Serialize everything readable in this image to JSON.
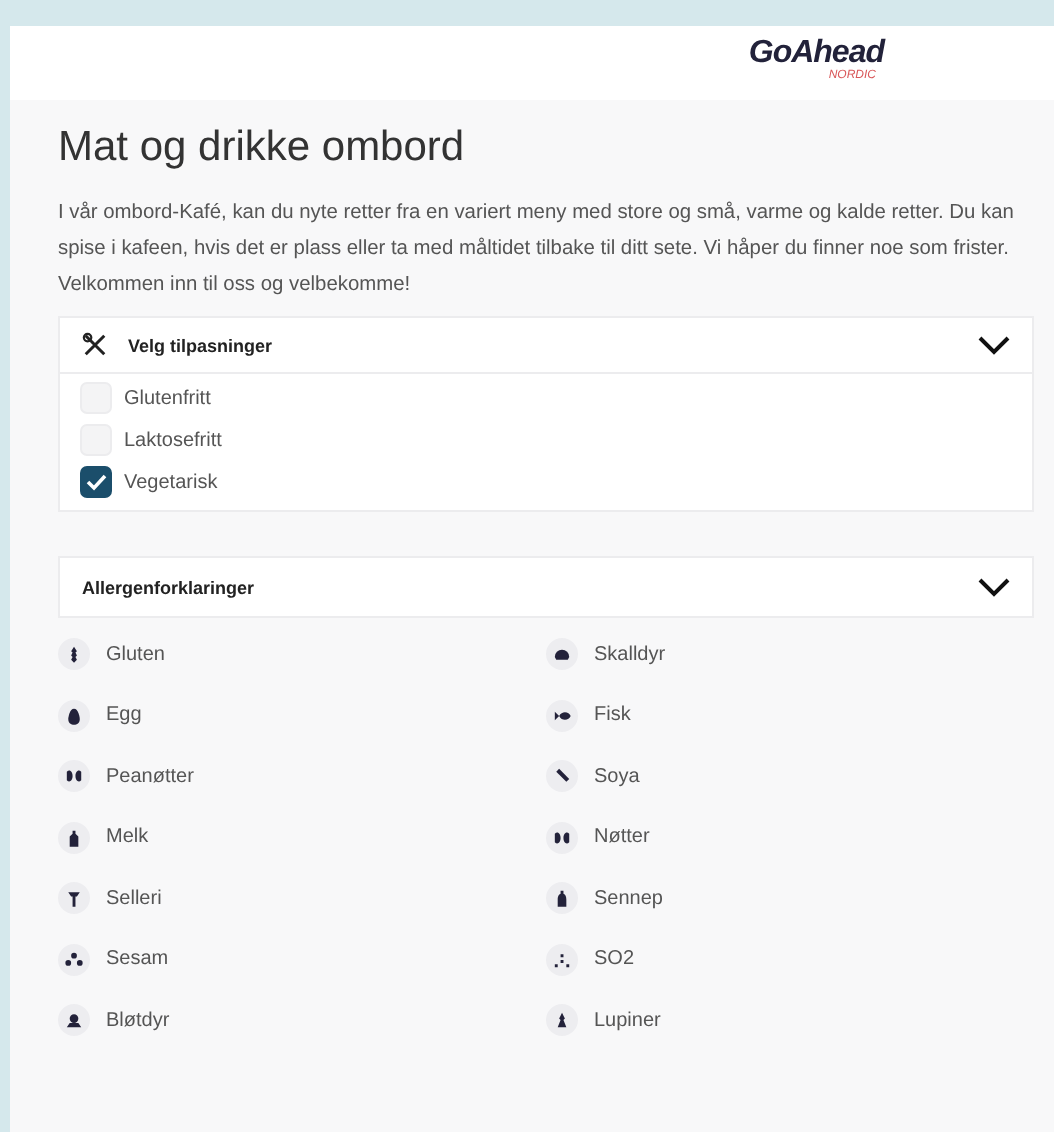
{
  "logo": {
    "name": "GoAhead",
    "sub": "NORDIC"
  },
  "title": "Mat og drikke ombord",
  "intro": "I vår ombord-Kafé, kan du nyte retter fra en variert meny med store og små, varme og kalde retter. Du kan spise i kafeen, hvis det er plass eller ta med måltidet tilbake til ditt sete. Vi håper du finner noe som frister. Velkommen inn til oss og velbekomme!",
  "filters": {
    "title": "Velg tilpasninger",
    "options": [
      {
        "label": "Glutenfritt",
        "checked": false
      },
      {
        "label": "Laktosefritt",
        "checked": false
      },
      {
        "label": "Vegetarisk",
        "checked": true
      }
    ]
  },
  "allergens": {
    "title": "Allergenforklaringer",
    "items": [
      {
        "label": "Gluten"
      },
      {
        "label": "Skalldyr"
      },
      {
        "label": "Egg"
      },
      {
        "label": "Fisk"
      },
      {
        "label": "Peanøtter"
      },
      {
        "label": "Soya"
      },
      {
        "label": "Melk"
      },
      {
        "label": "Nøtter"
      },
      {
        "label": "Selleri"
      },
      {
        "label": "Sennep"
      },
      {
        "label": "Sesam"
      },
      {
        "label": "SO2"
      },
      {
        "label": "Bløtdyr"
      },
      {
        "label": "Lupiner"
      }
    ]
  }
}
